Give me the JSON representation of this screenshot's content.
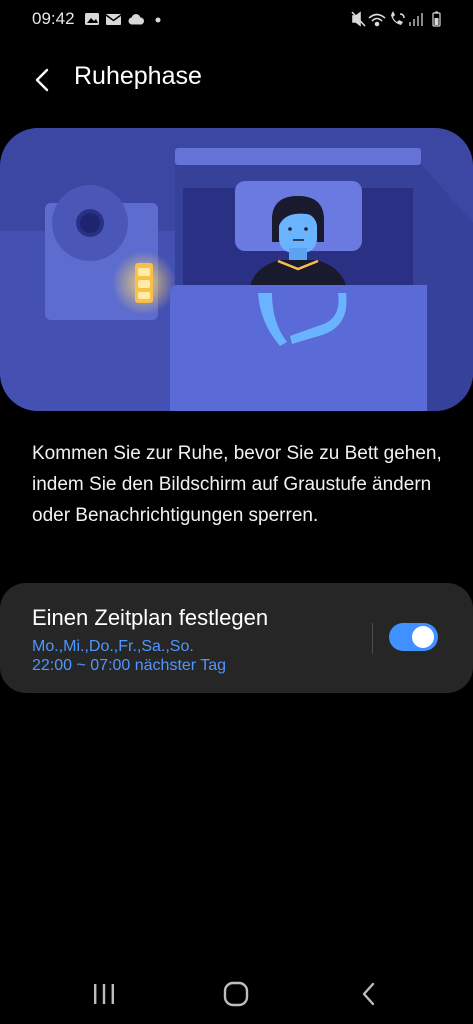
{
  "status_bar": {
    "time": "09:42"
  },
  "header": {
    "title": "Ruhephase"
  },
  "description": "Kommen Sie zur Ruhe, bevor Sie zu Bett gehen, indem Sie den Bildschirm auf Graustufe ändern oder Benachrichtigungen sperren.",
  "schedule": {
    "title": "Einen Zeitplan festlegen",
    "days": "Mo.,Mi.,Do.,Fr.,Sa.,So.",
    "time": "22:00 ~ 07:00 nächster Tag",
    "enabled": true
  },
  "colors": {
    "accent": "#3e91ff",
    "link_text": "#4f96ff",
    "card_bg": "#262626"
  }
}
